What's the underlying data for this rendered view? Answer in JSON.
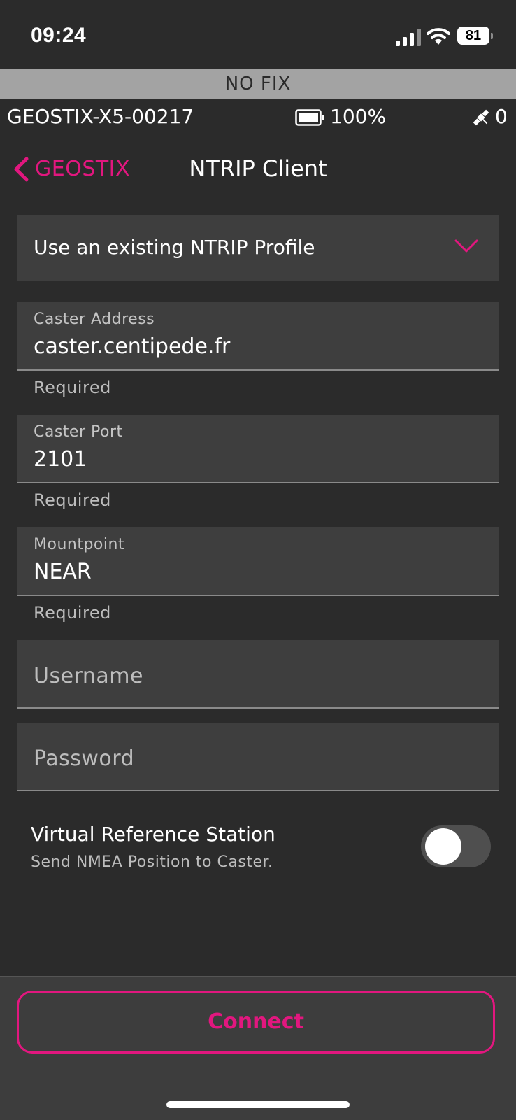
{
  "status_bar": {
    "time": "09:24",
    "battery": "81"
  },
  "fix_banner": "NO FIX",
  "device": {
    "name": "GEOSTIX-X5-00217",
    "battery": "100%",
    "satellites": "0"
  },
  "nav": {
    "back_label": "GEOSTIX",
    "title": "NTRIP Client"
  },
  "profile_select": {
    "label": "Use an existing NTRIP Profile"
  },
  "fields": {
    "caster_address": {
      "label": "Caster Address",
      "value": "caster.centipede.fr",
      "helper": "Required"
    },
    "caster_port": {
      "label": "Caster Port",
      "value": "2101",
      "helper": "Required"
    },
    "mountpoint": {
      "label": "Mountpoint",
      "value": "NEAR",
      "helper": "Required"
    },
    "username": {
      "placeholder": "Username"
    },
    "password": {
      "placeholder": "Password"
    }
  },
  "vrs": {
    "title": "Virtual Reference Station",
    "subtitle": "Send NMEA Position to Caster.",
    "enabled": false
  },
  "connect_button": "Connect",
  "colors": {
    "accent": "#e2177f",
    "background": "#2b2b2b",
    "card": "#3e3e3e"
  }
}
